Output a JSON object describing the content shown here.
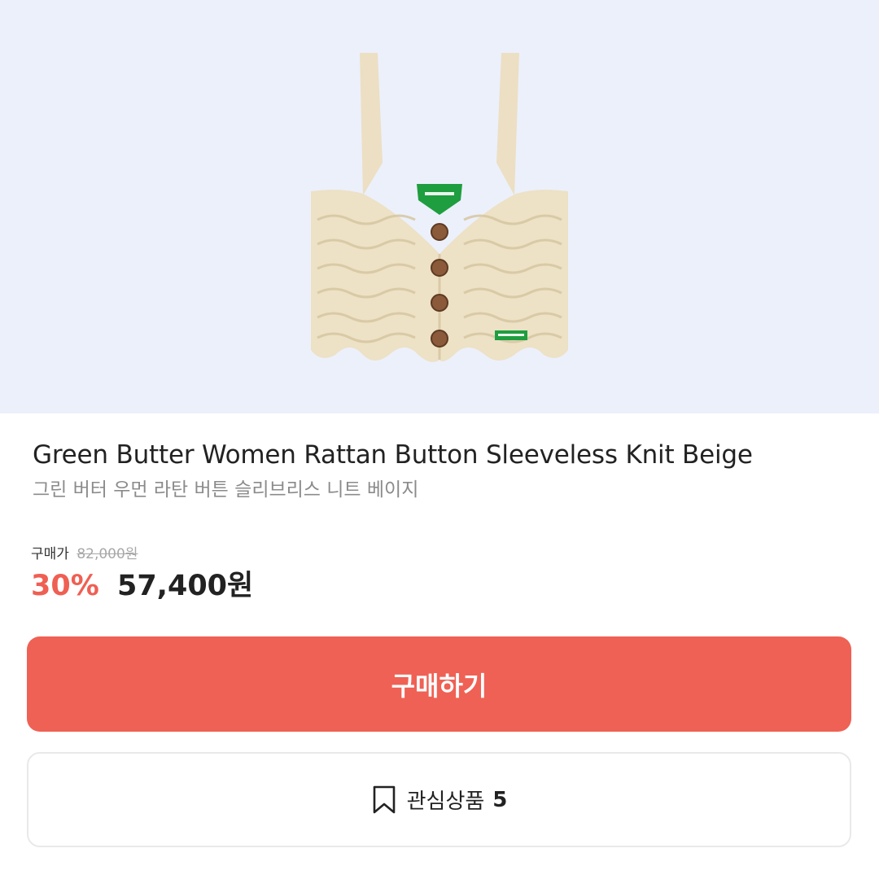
{
  "product": {
    "image_alt": "Beige crochet sleeveless knit vest with four brown buttons and green labels",
    "title": "Green Butter Women Rattan Button Sleeveless Knit Beige",
    "subtitle": "그린 버터 우먼 라탄 버튼 슬리브리스 니트 베이지"
  },
  "price": {
    "label": "구매가",
    "original": "82,000원",
    "discount": "30%",
    "current": "57,400원"
  },
  "actions": {
    "buy_label": "구매하기",
    "wish_label": "관심상품",
    "wish_count": "5"
  },
  "colors": {
    "accent": "#ef6154",
    "hero_background": "#ecf0fb",
    "knit_beige": "#ede1c6",
    "label_green": "#1f9e3f"
  }
}
